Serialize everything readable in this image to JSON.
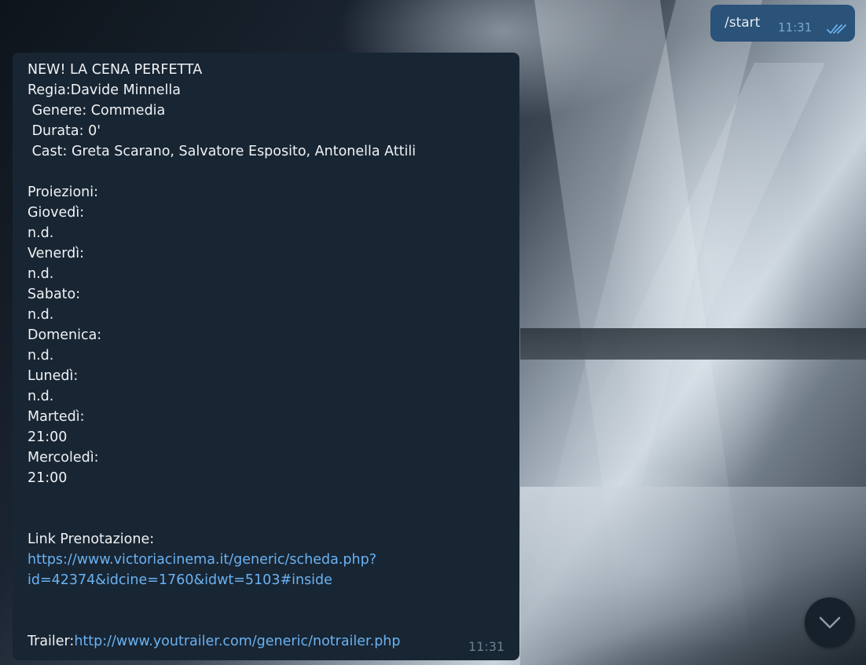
{
  "outgoing": {
    "text": "/start",
    "time": "11:31"
  },
  "incoming": {
    "lines": [
      "NEW! LA CENA PERFETTA",
      "Regia:Davide Minnella",
      " Genere: Commedia",
      " Durata: 0'",
      " Cast: Greta Scarano, Salvatore Esposito, Antonella Attili",
      "",
      "Proiezioni:",
      "Giovedì:",
      "n.d.",
      "Venerdì:",
      "n.d.",
      "Sabato:",
      "n.d.",
      "Domenica:",
      "n.d.",
      "Lunedì:",
      "n.d.",
      "Martedì:",
      "21:00",
      "Mercoledì:",
      "21:00",
      "",
      "",
      "Link Prenotazione:"
    ],
    "booking_link_line1": "https://www.victoriacinema.it/generic/scheda.php?",
    "booking_link_line2": "id=42374&idcine=1760&idwt=5103#inside",
    "trailer_label": "Trailer:",
    "trailer_link": "http://www.youtrailer.com/generic/notrailer.php",
    "time": "11:31"
  },
  "colors": {
    "incoming_bubble": "#182533",
    "outgoing_bubble": "#2b5278",
    "link": "#6ab2f2"
  },
  "icons": {
    "read_receipt": "double-check-icon",
    "scroll_down": "chevron-down-icon"
  }
}
